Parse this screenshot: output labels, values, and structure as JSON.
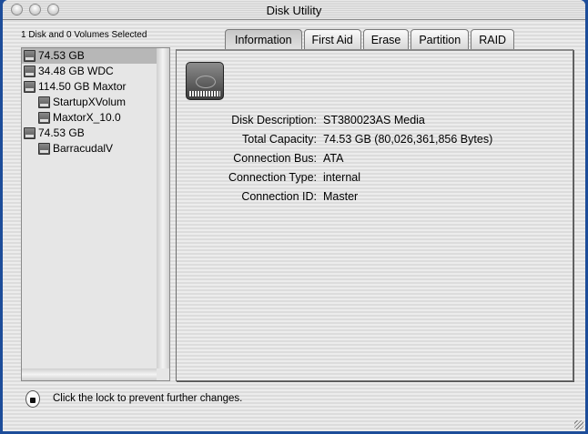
{
  "window": {
    "title": "Disk Utility"
  },
  "sidebar": {
    "selection_label": "1 Disk and 0 Volumes Selected",
    "items": [
      {
        "label": "74.53 GB",
        "type": "disk",
        "selected": true
      },
      {
        "label": "34.48 GB WDC",
        "type": "disk"
      },
      {
        "label": "114.50 GB Maxtor",
        "type": "disk"
      },
      {
        "label": "StartupXVolum",
        "type": "volume"
      },
      {
        "label": "MaxtorX_10.0",
        "type": "volume"
      },
      {
        "label": "74.53 GB",
        "type": "disk"
      },
      {
        "label": "BarracudalV",
        "type": "volume"
      }
    ]
  },
  "tabs": [
    {
      "label": "Information",
      "active": true
    },
    {
      "label": "First Aid"
    },
    {
      "label": "Erase"
    },
    {
      "label": "Partition"
    },
    {
      "label": "RAID"
    }
  ],
  "info": [
    {
      "label": "Disk Description:",
      "value": "ST380023AS Media"
    },
    {
      "label": "Total Capacity:",
      "value": "74.53 GB (80,026,361,856 Bytes)"
    },
    {
      "label": "Connection Bus:",
      "value": "ATA"
    },
    {
      "label": "Connection Type:",
      "value": "internal"
    },
    {
      "label": "Connection ID:",
      "value": "Master"
    }
  ],
  "footer": {
    "lock_text": "Click the lock to prevent further changes."
  }
}
